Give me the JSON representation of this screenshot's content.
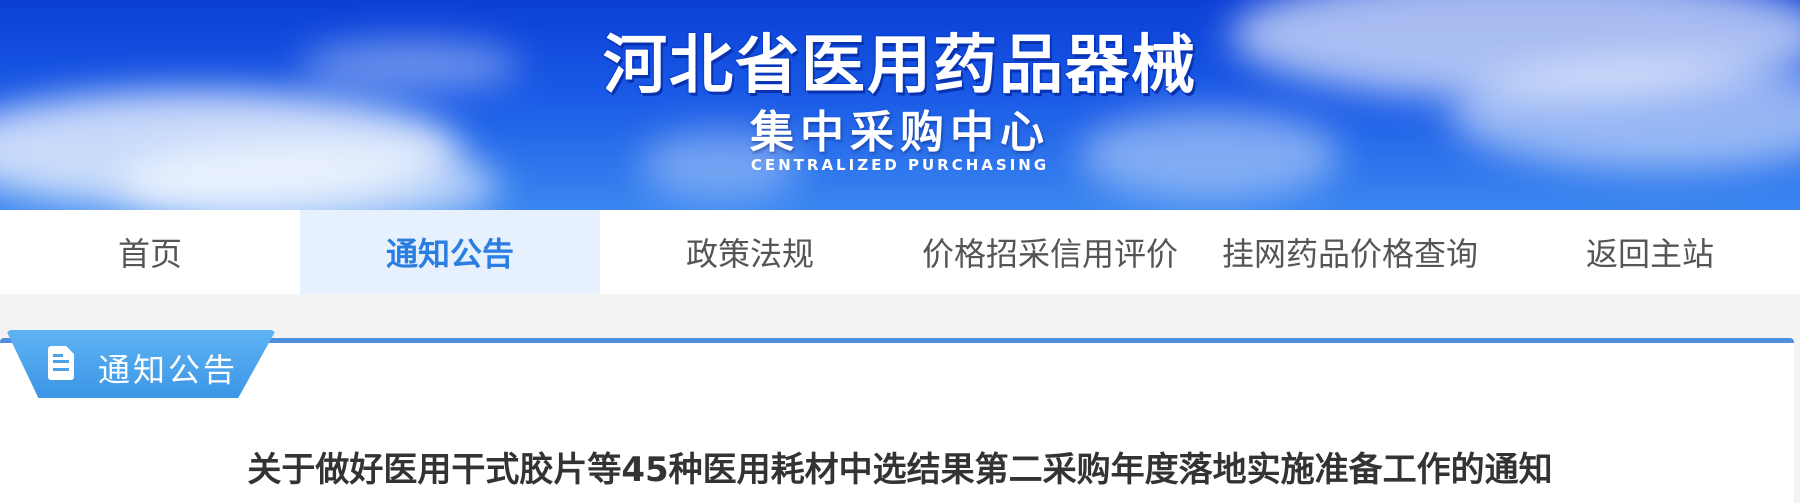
{
  "banner": {
    "title": "河北省医用药品器械",
    "subtitle": "集中采购中心",
    "english": "CENTRALIZED PURCHASING"
  },
  "nav": {
    "items": [
      {
        "label": "首页"
      },
      {
        "label": "通知公告"
      },
      {
        "label": "政策法规"
      },
      {
        "label": "价格招采信用评价"
      },
      {
        "label": "挂网药品价格查询"
      },
      {
        "label": "返回主站"
      }
    ],
    "active_index": 1
  },
  "section": {
    "tab_label": "通知公告",
    "icon": "document-icon"
  },
  "notice": {
    "title": "关于做好医用干式胶片等45种医用耗材中选结果第二采购年度落地实施准备工作的通知"
  },
  "colors": {
    "accent": "#2a7de1",
    "tab_blue": "#4aa2ea",
    "banner_blue": "#0a3fd6"
  }
}
